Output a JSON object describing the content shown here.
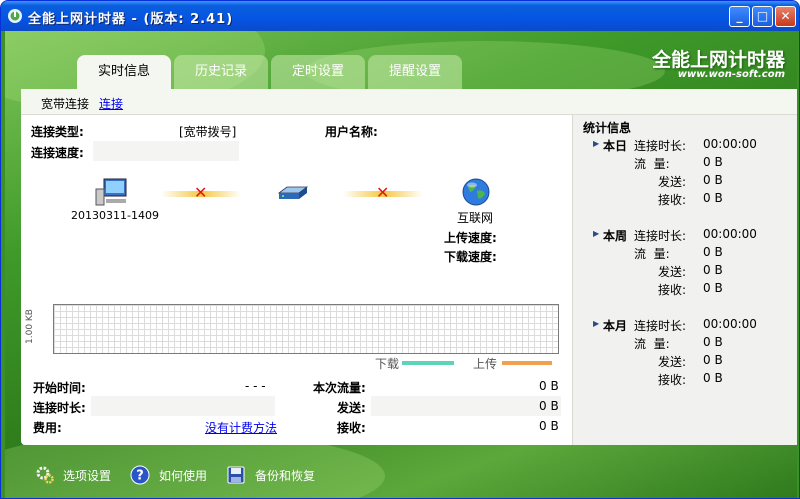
{
  "window": {
    "title": "全能上网计时器 - (版本: 2.41)",
    "title_icon": "app-icon"
  },
  "titlebar_buttons": [
    "minimize",
    "maximize",
    "close"
  ],
  "logo": {
    "title": "全能上网计时器",
    "url": "www.won-soft.com"
  },
  "tabs": [
    {
      "label": "实时信息",
      "active": true
    },
    {
      "label": "历史记录"
    },
    {
      "label": "定时设置"
    },
    {
      "label": "提醒设置"
    }
  ],
  "subbar": {
    "conn_name": "宽带连接",
    "conn_link": "连接"
  },
  "info": {
    "type_label": "连接类型:",
    "type_value": "[宽带拨号]",
    "user_label": "用户名称:",
    "user_value": "",
    "speed_label": "连接速度:",
    "speed_value": ""
  },
  "network": {
    "computer_name": "20130311-1409",
    "internet_label": "互联网",
    "upload_label": "上传速度:",
    "download_label": "下载速度:"
  },
  "graph": {
    "ylabel": "1.00 KB",
    "legend": [
      {
        "name": "下载",
        "color": "#5dd3b8"
      },
      {
        "name": "上传",
        "color": "#f0a04e"
      }
    ]
  },
  "bottom_info": {
    "start_label": "开始时间:",
    "start_value": "- - -",
    "duration_label": "连接时长:",
    "duration_value": "",
    "fee_label": "费用:",
    "fee_link": "没有计费方法",
    "flow_label": "本次流量:",
    "flow_value": "0 B",
    "sent_label": "发送:",
    "sent_value": "0 B",
    "recv_label": "接收:",
    "recv_value": "0 B"
  },
  "stats": {
    "title": "统计信息",
    "groups": [
      {
        "name": "本日",
        "duration_label": "连接时长:",
        "duration": "00:00:00",
        "flow_label": "流  量:",
        "flow": "0 B",
        "sent_label": "发送:",
        "sent": "0 B",
        "recv_label": "接收:",
        "recv": "0 B"
      },
      {
        "name": "本周",
        "duration_label": "连接时长:",
        "duration": "00:00:00",
        "flow_label": "流  量:",
        "flow": "0 B",
        "sent_label": "发送:",
        "sent": "0 B",
        "recv_label": "接收:",
        "recv": "0 B"
      },
      {
        "name": "本月",
        "duration_label": "连接时长:",
        "duration": "00:00:00",
        "flow_label": "流  量:",
        "flow": "0 B",
        "sent_label": "发送:",
        "sent": "0 B",
        "recv_label": "接收:",
        "recv": "0 B"
      }
    ]
  },
  "bottom_menu": [
    {
      "label": "选项设置",
      "icon": "gears-icon"
    },
    {
      "label": "如何使用",
      "icon": "help-icon"
    },
    {
      "label": "备份和恢复",
      "icon": "floppy-disk-icon"
    }
  ]
}
